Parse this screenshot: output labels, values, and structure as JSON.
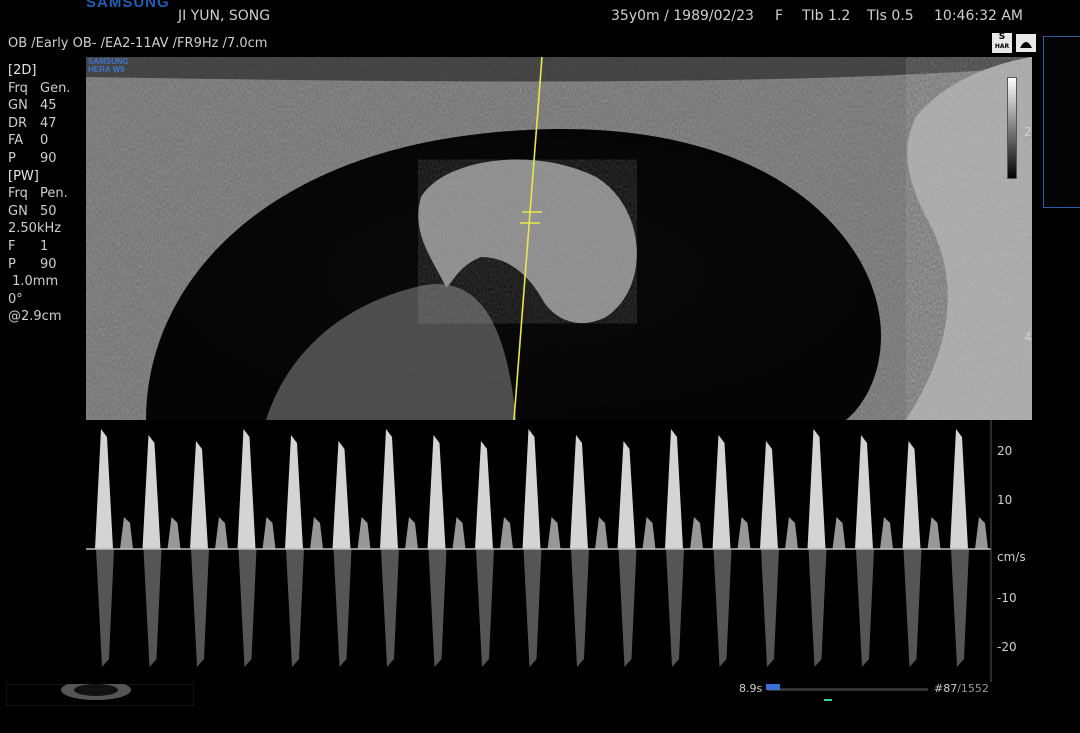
{
  "header": {
    "brand": "SAMSUNG",
    "patient_name": "JI YUN, SONG",
    "patient_age_dob": "35y0m / 1989/02/23",
    "sex": "F",
    "tib": "TIb 1.2",
    "tis": "TIs 0.5",
    "time": "10:46:32 AM"
  },
  "preset": {
    "exam": "OB /Early OB- /EA2-11AV /FR9Hz /7.0cm"
  },
  "params_2d": {
    "section": "[2D]",
    "rows": [
      {
        "k": "Frq",
        "v": "Gen."
      },
      {
        "k": "GN",
        "v": "45"
      },
      {
        "k": "DR",
        "v": "47"
      },
      {
        "k": "FA",
        "v": "0"
      },
      {
        "k": "P",
        "v": "90"
      }
    ]
  },
  "params_pw": {
    "section": "[PW]",
    "rows": [
      {
        "k": "Frq",
        "v": "Pen."
      },
      {
        "k": "GN",
        "v": "50"
      },
      {
        "k": "",
        "v": "2.50kHz"
      },
      {
        "k": "F",
        "v": "1"
      },
      {
        "k": "P",
        "v": "90"
      },
      {
        "k": "",
        "v": " 1.0mm"
      },
      {
        "k": "",
        "v": "0°"
      },
      {
        "k": "",
        "v": "@2.9cm"
      }
    ]
  },
  "badges": {
    "s_top": "S",
    "s_bottom": "HAR"
  },
  "image": {
    "logo_line1": "SAMSUNG",
    "logo_line2": "HERA W9"
  },
  "depth_marks": [
    "2",
    "4"
  ],
  "velocity_scale": {
    "labels": [
      "20",
      "10",
      "cm/s",
      "-10",
      "-20"
    ]
  },
  "cine": {
    "time": "8.9s",
    "frame": "#87",
    "total": "/1552",
    "position": 0.056
  },
  "colors": {
    "brand_blue": "#1f5fb8",
    "sample_line": "#e8e84a",
    "cine_blue": "#3b6fd6"
  }
}
